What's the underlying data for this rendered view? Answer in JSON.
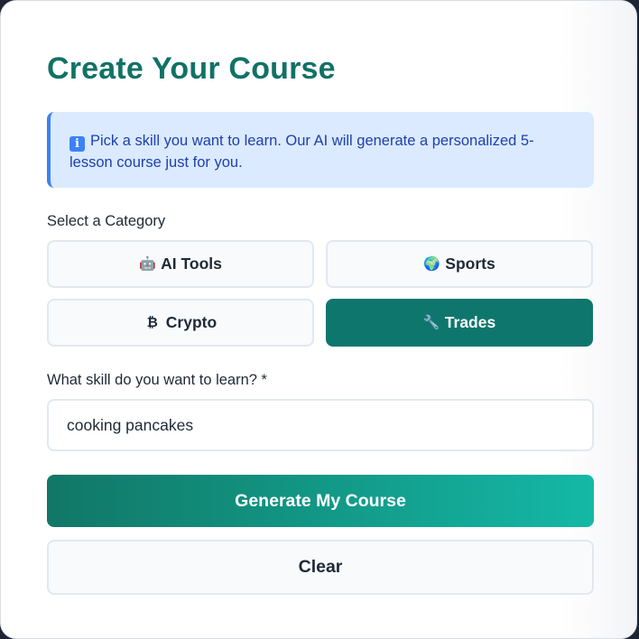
{
  "page": {
    "title": "Create Your Course"
  },
  "info": {
    "icon": "info-icon",
    "icon_glyph": "i",
    "text": "Pick a skill you want to learn. Our AI will generate a personalized 5-lesson course just for you."
  },
  "category": {
    "label": "Select a Category",
    "selected": "Trades",
    "options": [
      {
        "label": "AI Tools",
        "icon": "robot-icon",
        "glyph": "🤖"
      },
      {
        "label": "Sports",
        "icon": "globe-icon",
        "glyph": "🌍"
      },
      {
        "label": "Crypto",
        "icon": "bitcoin-icon",
        "glyph": "₿"
      },
      {
        "label": "Trades",
        "icon": "wrench-icon",
        "glyph": "🔧"
      }
    ]
  },
  "skill": {
    "label": "What skill do you want to learn? *",
    "value": "cooking pancakes"
  },
  "actions": {
    "generate_label": "Generate My Course",
    "clear_label": "Clear"
  },
  "colors": {
    "accent": "#0f766e",
    "title": "#117266",
    "info_bg": "#dbeafe",
    "info_border": "#3b82f6",
    "gradient_end": "#14b8a6"
  }
}
